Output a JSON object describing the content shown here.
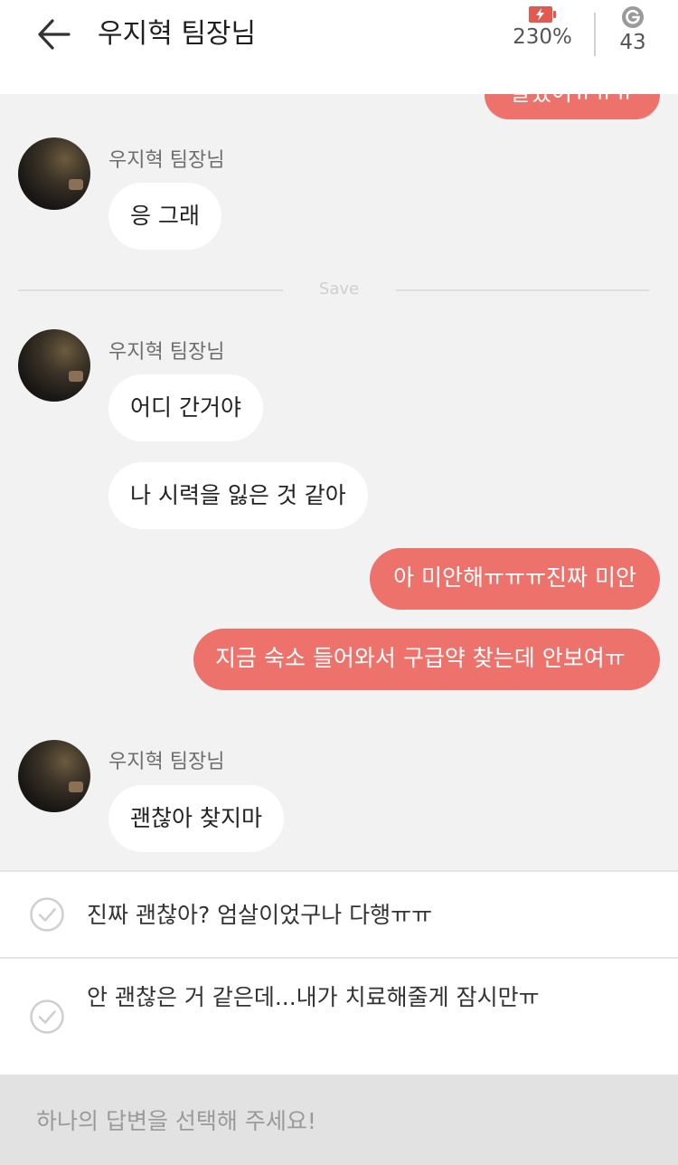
{
  "header": {
    "title": "우지혁 팀장님",
    "battery": {
      "icon": "battery-charging-icon",
      "value": "230%"
    },
    "coin": {
      "icon": "coin-g-icon",
      "value": "43"
    }
  },
  "colors": {
    "accent": "#ec726b",
    "background": "#f2f2f2",
    "bubble_in": "#ffffff"
  },
  "chat": {
    "partial_top_text": "알겠어ㅠㅠㅠ",
    "divider_label": "Save",
    "sender_name": "우지혁 팀장님",
    "messages": {
      "m1": "응 그래",
      "m2": "어디 간거야",
      "m3": "나 시력을 잃은 것 같아",
      "m4": "아 미안해ㅠㅠㅠ진짜 미안",
      "m5": "지금 숙소 들어와서 구급약 찾는데 안보여ㅠ",
      "m6": "괜찮아 찾지마"
    }
  },
  "choices": [
    {
      "text": "진짜 괜찮아? 엄살이었구나 다행ㅠㅠ",
      "icon": "check-circle-icon"
    },
    {
      "text": "안 괜찮은 거 같은데...내가 치료해줄게 잠시만ㅠ",
      "icon": "check-circle-icon"
    }
  ],
  "footer": {
    "prompt": "하나의 답변을 선택해 주세요!"
  }
}
